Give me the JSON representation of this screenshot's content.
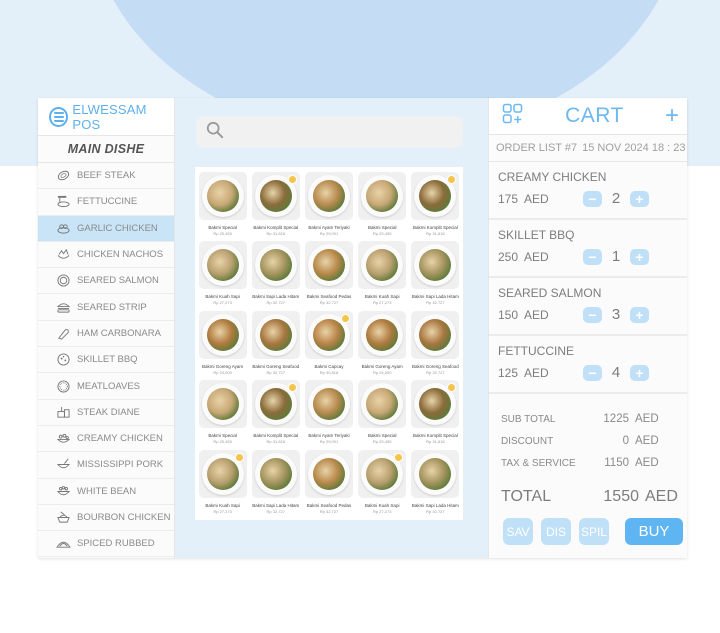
{
  "brand": {
    "name": "ELWESSAM POS",
    "icon": "menu-circle-icon"
  },
  "sidebar": {
    "section_title": "MAIN DISHE",
    "items": [
      {
        "label": "BEEF STEAK",
        "icon": "steak-icon",
        "active": false
      },
      {
        "label": "FETTUCCINE",
        "icon": "noodles-icon",
        "active": false
      },
      {
        "label": "GARLIC CHICKEN",
        "icon": "chicken-icon",
        "active": true
      },
      {
        "label": "CHICKEN NACHOS",
        "icon": "nachos-icon",
        "active": false
      },
      {
        "label": "SEARED SALMON",
        "icon": "plate-icon",
        "active": false
      },
      {
        "label": "SEARED STRIP",
        "icon": "burger-icon",
        "active": false
      },
      {
        "label": "HAM CARBONARA",
        "icon": "ham-icon",
        "active": false
      },
      {
        "label": "SKILLET BBQ",
        "icon": "pizza-icon",
        "active": false
      },
      {
        "label": "MEATLOAVES",
        "icon": "pie-icon",
        "active": false
      },
      {
        "label": "STEAK DIANE",
        "icon": "sandwich-icon",
        "active": false
      },
      {
        "label": "CREAMY CHICKEN",
        "icon": "salad-bowl-icon",
        "active": false
      },
      {
        "label": "MISSISSIPPI PORK",
        "icon": "bowl-spoon-icon",
        "active": false
      },
      {
        "label": "WHITE BEAN",
        "icon": "bean-bowl-icon",
        "active": false
      },
      {
        "label": "BOURBON CHICKEN",
        "icon": "rice-bowl-icon",
        "active": false
      },
      {
        "label": "SPICED RUBBED",
        "icon": "taco-icon",
        "active": false
      }
    ]
  },
  "search": {
    "placeholder": "",
    "value": "",
    "icon": "search-icon"
  },
  "products": [
    {
      "name": "Bakmi Special",
      "price": "Rp 25,455",
      "badge": false,
      "color": "#c9a876"
    },
    {
      "name": "Bakmi Komplit Special",
      "price": "Rp 31,818",
      "badge": true,
      "color": "#8a6b3a"
    },
    {
      "name": "Bakmi Ayam Teriyaki",
      "price": "Rp 29,091",
      "badge": false,
      "color": "#b88a4e"
    },
    {
      "name": "Bakmi Special",
      "price": "Rp 25,455",
      "badge": false,
      "color": "#c9a876"
    },
    {
      "name": "Bakmi Komplit Special",
      "price": "Rp 31,818",
      "badge": true,
      "color": "#8a6b3a"
    },
    {
      "name": "Bakmi Kuah Sapi",
      "price": "Rp 27,273",
      "badge": false,
      "color": "#b9a070"
    },
    {
      "name": "Bakmi Sapi Lada Hitam",
      "price": "Rp 32,727",
      "badge": false,
      "color": "#a5955f"
    },
    {
      "name": "Bakmi Seafood Pedas",
      "price": "Rp 32,727",
      "badge": false,
      "color": "#b8894a"
    },
    {
      "name": "Bakmi Kuah Sapi",
      "price": "Rp 27,273",
      "badge": false,
      "color": "#b9a070"
    },
    {
      "name": "Bakmi Sapi Lada Hitam",
      "price": "Rp 32,727",
      "badge": false,
      "color": "#a5955f"
    },
    {
      "name": "Bakmi Goreng Ayam",
      "price": "Rp 24,000",
      "badge": false,
      "color": "#b07a3e"
    },
    {
      "name": "Bakmi Goreng Seafood",
      "price": "Rp 32,727",
      "badge": false,
      "color": "#a87640"
    },
    {
      "name": "Bakmi Capcay",
      "price": "Rp 30,818",
      "badge": true,
      "color": "#b98347"
    },
    {
      "name": "Bakmi Goreng Ayam",
      "price": "Rp 24,000",
      "badge": false,
      "color": "#b07a3e"
    },
    {
      "name": "Bakmi Goreng Seafood",
      "price": "Rp 32,727",
      "badge": false,
      "color": "#a87640"
    },
    {
      "name": "Bakmi Special",
      "price": "Rp 25,455",
      "badge": false,
      "color": "#c9a876"
    },
    {
      "name": "Bakmi Komplit Special",
      "price": "Rp 31,818",
      "badge": true,
      "color": "#8a6b3a"
    },
    {
      "name": "Bakmi Ayam Teriyaki",
      "price": "Rp 29,091",
      "badge": false,
      "color": "#b88a4e"
    },
    {
      "name": "Bakmi Special",
      "price": "Rp 25,455",
      "badge": false,
      "color": "#c9a876"
    },
    {
      "name": "Bakmi Komplit Special",
      "price": "Rp 31,818",
      "badge": true,
      "color": "#8a6b3a"
    },
    {
      "name": "Bakmi Kuah Sapi",
      "price": "Rp 27,273",
      "badge": true,
      "color": "#b9a070"
    },
    {
      "name": "Bakmi Sapi Lada Hitam",
      "price": "Rp 32,727",
      "badge": false,
      "color": "#a5955f"
    },
    {
      "name": "Bakmi Seafood Pedas",
      "price": "Rp 32,727",
      "badge": false,
      "color": "#b8894a"
    },
    {
      "name": "Bakmi Kuah Sapi",
      "price": "Rp 27,273",
      "badge": true,
      "color": "#b9a070"
    },
    {
      "name": "Bakmi Sapi Lada Hitam",
      "price": "Rp 32,727",
      "badge": false,
      "color": "#a5955f"
    }
  ],
  "cart": {
    "title": "CART",
    "add_label": "+",
    "order_label": "ORDER LIST #7",
    "order_date": "15 NOV 2024 18 : 23",
    "currency": "AED",
    "minus_label": "−",
    "plus_label": "+",
    "items": [
      {
        "name": "CREAMY CHICKEN",
        "price": "175",
        "qty": "2"
      },
      {
        "name": "SKILLET BBQ",
        "price": "250",
        "qty": "1"
      },
      {
        "name": "SEARED SALMON",
        "price": "150",
        "qty": "3"
      },
      {
        "name": "FETTUCCINE",
        "price": "125",
        "qty": "4"
      }
    ],
    "summary": {
      "subtotal_label": "SUB TOTAL",
      "subtotal": "1225",
      "discount_label": "DISCOUNT",
      "discount": "0",
      "tax_label": "TAX & SERVICE",
      "tax": "1150",
      "total_label": "TOTAL",
      "total": "1550"
    },
    "actions": {
      "save": "SAV",
      "discount": "DIS",
      "split": "SPIL",
      "buy": "BUY"
    }
  },
  "colors": {
    "accent": "#5eb5f1",
    "accent_light": "#bfe0f7",
    "active_item": "#c9e4f7",
    "badge": "#f5c54a",
    "background": "#e3eff9"
  }
}
